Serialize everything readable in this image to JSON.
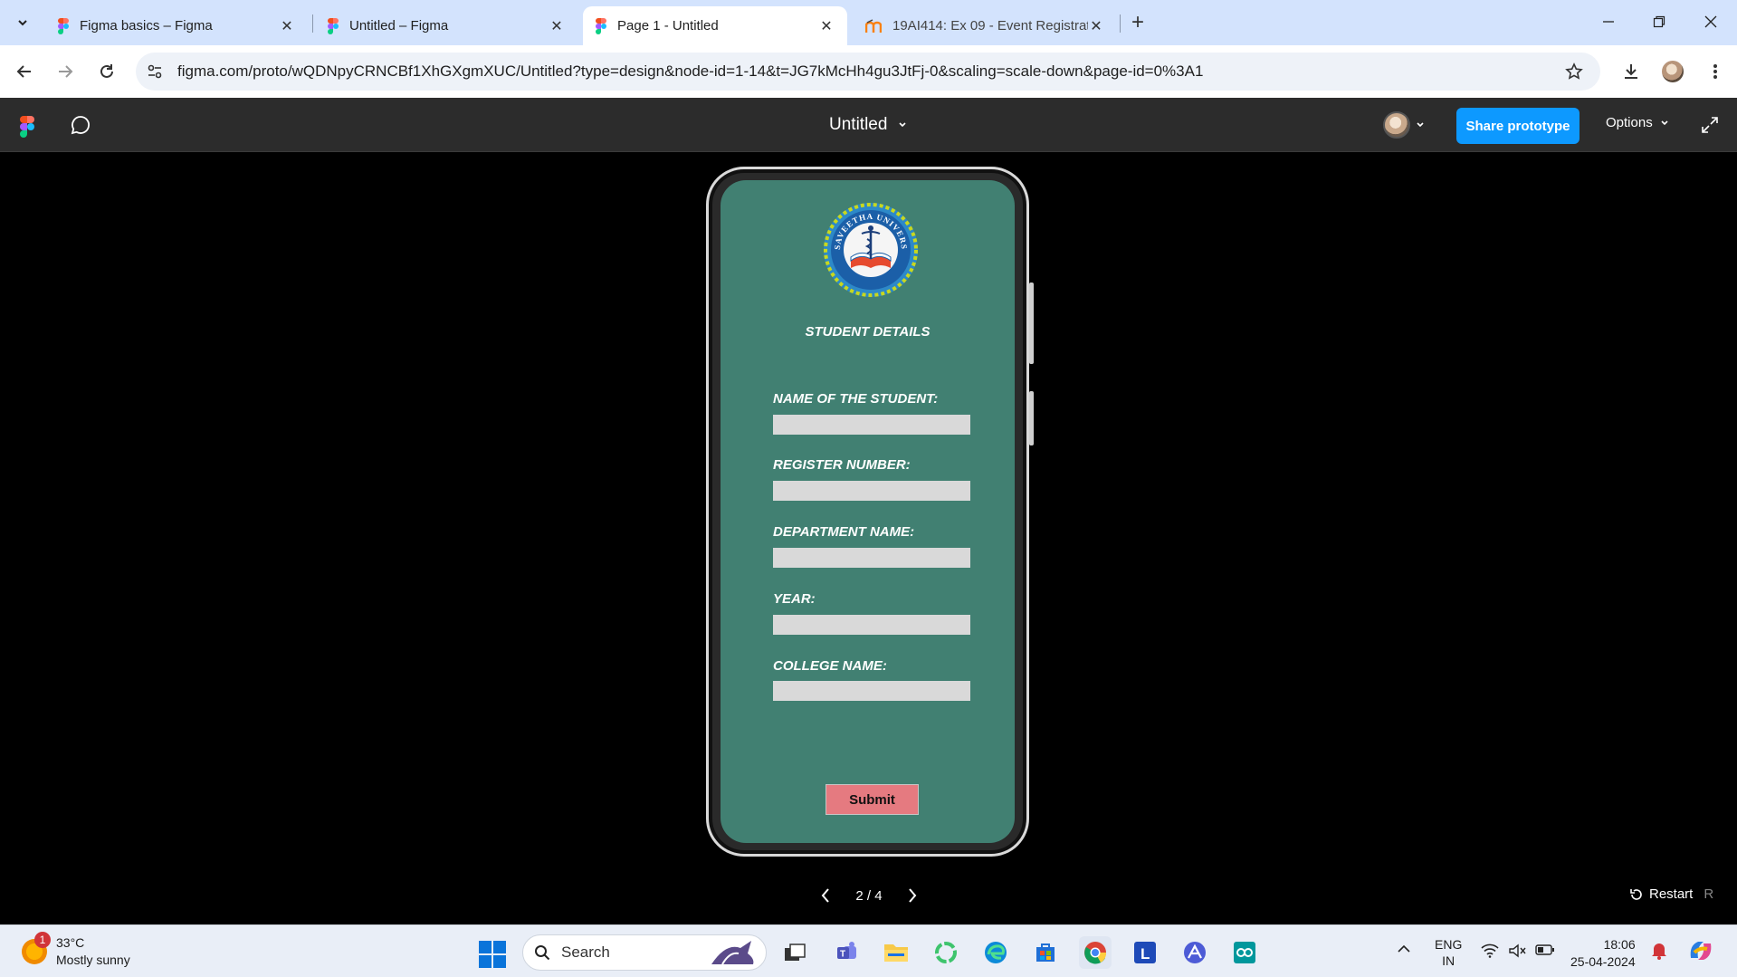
{
  "browser": {
    "tabs": [
      {
        "title": "Figma basics – Figma",
        "favicon": "figma-icon",
        "active": false
      },
      {
        "title": "Untitled – Figma",
        "favicon": "figma-icon",
        "active": false
      },
      {
        "title": "Page 1 - Untitled",
        "favicon": "figma-icon",
        "active": true
      },
      {
        "title": "19AI414: Ex 09 - Event Registrat",
        "favicon": "moodle-icon",
        "active": false
      }
    ],
    "url": "figma.com/proto/wQDNpyCRNCBf1XhGXgmXUC/Untitled?type=design&node-id=1-14&t=JG7kMcHh4gu3JtFj-0&scaling=scale-down&page-id=0%3A1"
  },
  "figma": {
    "doc_title": "Untitled",
    "share_label": "Share prototype",
    "options_label": "Options",
    "pager": "2 / 4",
    "restart_label": "Restart",
    "restart_key": "R",
    "accent": "#0d99ff"
  },
  "prototype": {
    "logo_text": "SAVEETHA UNIVERSITY",
    "title": "STUDENT DETAILS",
    "fields": [
      {
        "label": "NAME OF THE STUDENT:",
        "value": ""
      },
      {
        "label": "REGISTER NUMBER:",
        "value": ""
      },
      {
        "label": "DEPARTMENT NAME:",
        "value": ""
      },
      {
        "label": "YEAR:",
        "value": ""
      },
      {
        "label": "COLLEGE NAME:",
        "value": ""
      }
    ],
    "submit_label": "Submit",
    "screen_color": "#418072",
    "button_color": "#e57a80"
  },
  "taskbar": {
    "weather_temp": "33°C",
    "weather_desc": "Mostly sunny",
    "weather_badge": "1",
    "search_placeholder": "Search",
    "lang_top": "ENG",
    "lang_bottom": "IN",
    "time": "18:06",
    "date": "25-04-2024"
  }
}
